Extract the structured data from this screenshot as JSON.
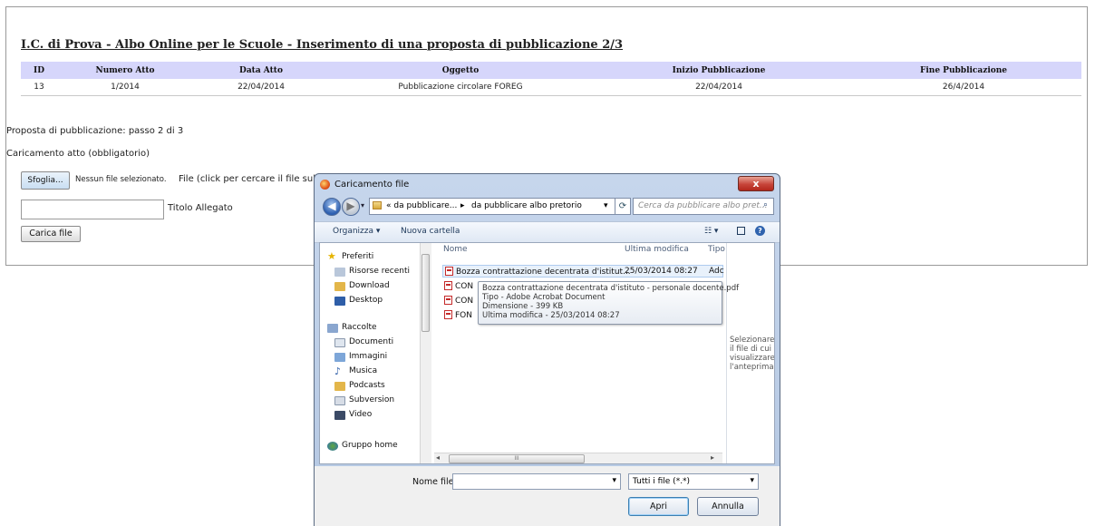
{
  "page": {
    "title": "I.C. di Prova - Albo Online per le Scuole - Inserimento di una proposta di pubblicazione 2/3",
    "table": {
      "headers": [
        "ID",
        "Numero Atto",
        "Data Atto",
        "Oggetto",
        "Inizio Pubblicazione",
        "Fine Pubblicazione"
      ],
      "rows": [
        [
          "13",
          "1/2014",
          "22/04/2014",
          "Pubblicazione circolare FOREG",
          "22/04/2014",
          "26/4/2014"
        ]
      ]
    },
    "step_text": "Proposta di pubblicazione: passo 2 di 3",
    "upload_label": "Caricamento atto (obbligatorio)",
    "browse_button": "Sfoglia...",
    "no_file_text": "Nessun file selezionato.",
    "file_hint": "File (click per cercare il file sul tu",
    "attachment_title_label": "Titolo Allegato",
    "attachment_title_value": "",
    "upload_button": "Carica file"
  },
  "dialog": {
    "caption": "Caricamento file",
    "close_label": "x",
    "breadcrumb": [
      "« da pubblicare...",
      "▸",
      "da pubblicare albo pretorio"
    ],
    "search_placeholder": "Cerca da pubblicare albo pret...",
    "toolbar": {
      "organize": "Organizza ▾",
      "new_folder": "Nuova cartella",
      "views": "☷ ▾"
    },
    "nav": {
      "favorites_header": "Preferiti",
      "favorites": [
        "Risorse recenti",
        "Download",
        "Desktop"
      ],
      "libraries_header": "Raccolte",
      "libraries": [
        "Documenti",
        "Immagini",
        "Musica",
        "Podcasts",
        "Subversion",
        "Video"
      ],
      "homegroup": "Gruppo home"
    },
    "columns": {
      "name": "Nome",
      "modified": "Ultima modifica",
      "type": "Tipo"
    },
    "files": [
      {
        "name": "Bozza contrattazione decentrata d'istitut...",
        "modified": "25/03/2014 08:27",
        "type": "Adc"
      },
      {
        "name": "CON",
        "modified": "",
        "type": ""
      },
      {
        "name": "CON",
        "modified": "",
        "type": ""
      },
      {
        "name": "FON",
        "modified": "",
        "type": ""
      }
    ],
    "tooltip": {
      "title": "Bozza contrattazione decentrata d'istituto - personale docente.pdf",
      "type": "Tipo - Adobe Acrobat Document",
      "size": "Dimensione - 399 KB",
      "modified": "Ultima modifica - 25/03/2014 08:27"
    },
    "preview_text": [
      "Selezionare",
      "il file di cui",
      "visualizzare",
      "l'anteprima."
    ],
    "filename_label": "Nome file:",
    "filename_value": "",
    "filetype": "Tutti i file (*.*)",
    "open_button": "Apri",
    "cancel_button": "Annulla",
    "scroll_grip": "III"
  },
  "colors": {
    "table_header_bg": "#d6d6fb",
    "dialog_frame": "#b4c7e2",
    "close_button": "#c7453a",
    "pdf_icon": "#c42a2a"
  }
}
